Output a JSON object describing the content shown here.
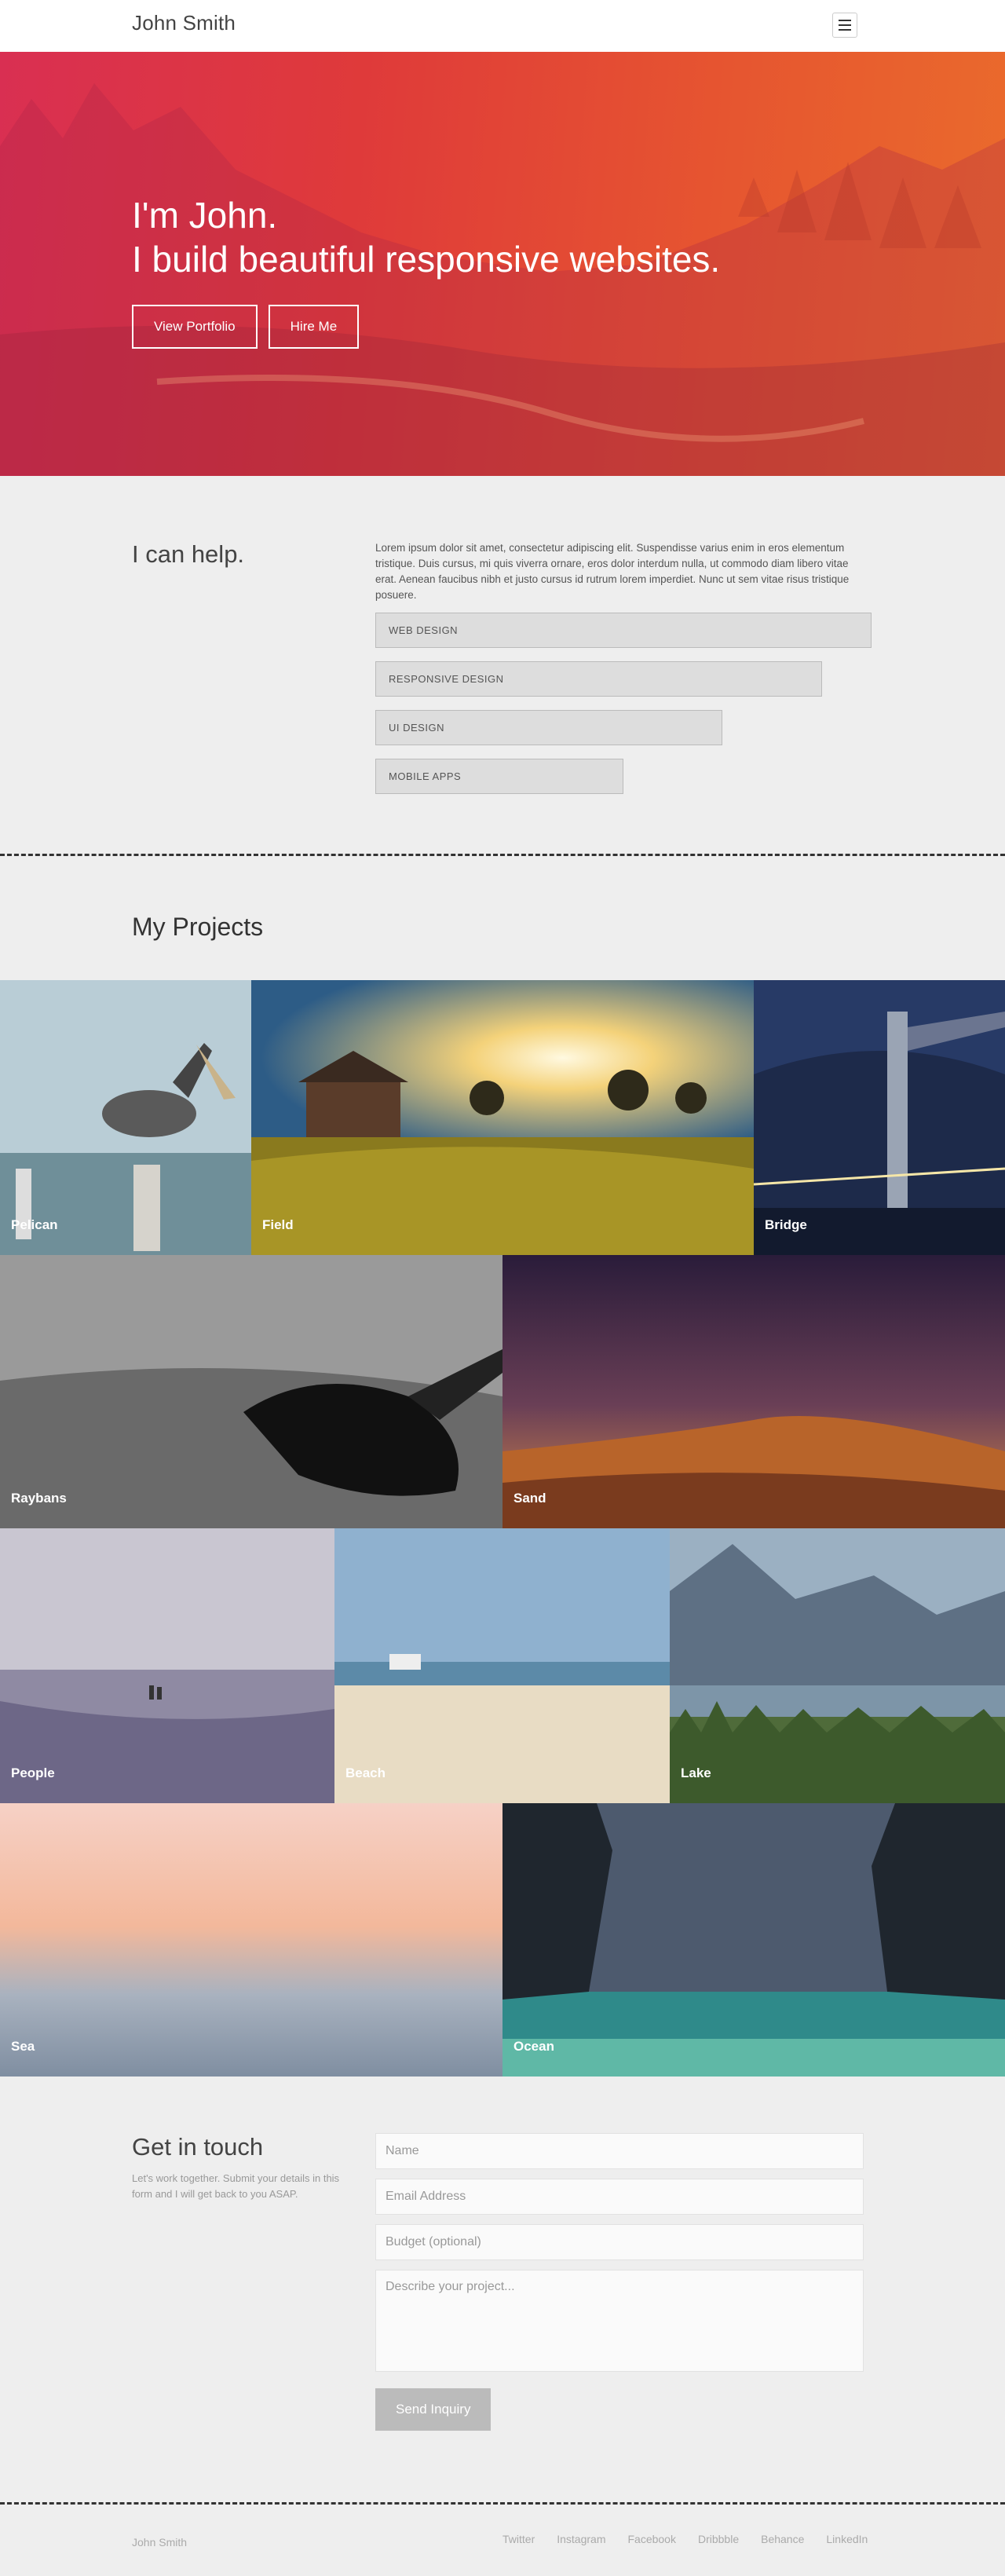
{
  "header": {
    "brand": "John Smith",
    "menu_icon": "hamburger-icon"
  },
  "hero": {
    "greeting": "I'm John.",
    "tagline": "I build beautiful responsive websites.",
    "buttons": {
      "portfolio": "View Portfolio",
      "hire": "Hire Me"
    }
  },
  "services": {
    "title": "I can help.",
    "text": "Lorem ipsum dolor sit amet, consectetur adipiscing elit. Suspendisse varius enim in eros elementum tristique. Duis cursus, mi quis viverra ornare, eros dolor interdum nulla, ut commodo diam libero vitae erat. Aenean faucibus nibh et justo cursus id rutrum lorem imperdiet. Nunc ut sem vitae risus tristique posuere.",
    "skills": [
      {
        "label": "Web Design",
        "level": 1.0
      },
      {
        "label": "Responsive Design",
        "level": 0.9
      },
      {
        "label": "UI Design",
        "level": 0.7
      },
      {
        "label": "Mobile Apps",
        "level": 0.5
      }
    ]
  },
  "projects": {
    "title": "My Projects",
    "items": [
      {
        "label": "Pelican"
      },
      {
        "label": "Field"
      },
      {
        "label": "Bridge"
      },
      {
        "label": "Raybans"
      },
      {
        "label": "Sand"
      },
      {
        "label": "People"
      },
      {
        "label": "Beach"
      },
      {
        "label": "Lake"
      },
      {
        "label": "Sea"
      },
      {
        "label": "Ocean"
      }
    ]
  },
  "contact": {
    "title": "Get in touch",
    "description": "Let's work together. Submit your details in this form and I will get back to you ASAP.",
    "placeholders": {
      "name": "Name",
      "email": "Email Address",
      "budget": "Budget (optional)",
      "project": "Describe your project..."
    },
    "submit": "Send Inquiry"
  },
  "footer": {
    "name": "John Smith",
    "social": [
      "Twitter",
      "Instagram",
      "Facebook",
      "Dribbble",
      "Behance",
      "LinkedIn"
    ]
  }
}
